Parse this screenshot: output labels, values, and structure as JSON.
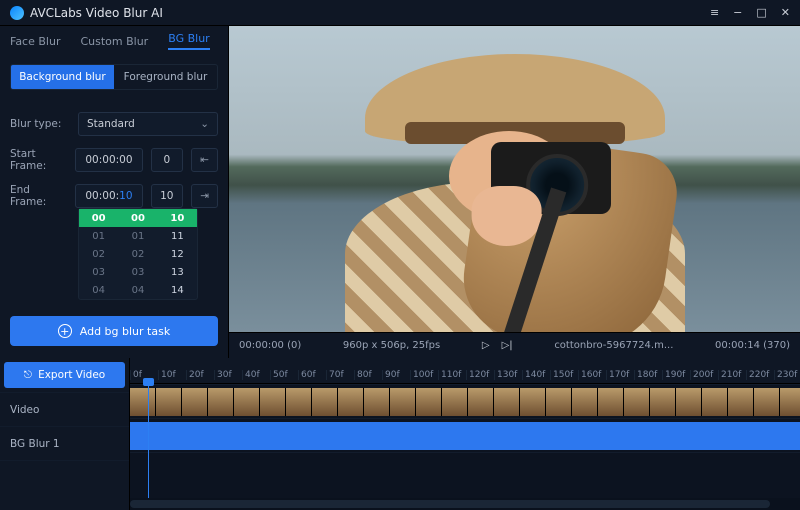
{
  "app": {
    "title": "AVCLabs Video Blur AI"
  },
  "tabs": {
    "face": "Face Blur",
    "custom": "Custom Blur",
    "bg": "BG Blur"
  },
  "seg": {
    "background": "Background blur",
    "foreground": "Foreground blur"
  },
  "form": {
    "blurtype_lbl": "Blur type:",
    "blurtype_val": "Standard",
    "start_lbl": "Start Frame:",
    "start_time": "00:00:00",
    "start_num": "0",
    "end_lbl": "End Frame:",
    "end_time_prefix": "00:00:",
    "end_time_hl": "10",
    "end_num": "10"
  },
  "picker": {
    "rows": [
      {
        "a": "00",
        "b": "00",
        "c": "10"
      },
      {
        "a": "01",
        "b": "01",
        "c": "11"
      },
      {
        "a": "02",
        "b": "02",
        "c": "12"
      },
      {
        "a": "03",
        "b": "03",
        "c": "13"
      },
      {
        "a": "04",
        "b": "04",
        "c": "14"
      }
    ]
  },
  "add_btn": "Add bg blur task",
  "export_btn": "Export Video",
  "playbar": {
    "cur": "00:00:00 (0)",
    "dim": "960p x 506p, 25fps",
    "file": "cottonbro-5967724.m...",
    "total": "00:00:14 (370)"
  },
  "ruler": [
    "0f",
    "10f",
    "20f",
    "30f",
    "40f",
    "50f",
    "60f",
    "70f",
    "80f",
    "90f",
    "100f",
    "110f",
    "120f",
    "130f",
    "140f",
    "150f",
    "160f",
    "170f",
    "180f",
    "190f",
    "200f",
    "210f",
    "220f",
    "230f"
  ],
  "tracks": {
    "video": "Video",
    "bgblur": "BG Blur 1"
  }
}
